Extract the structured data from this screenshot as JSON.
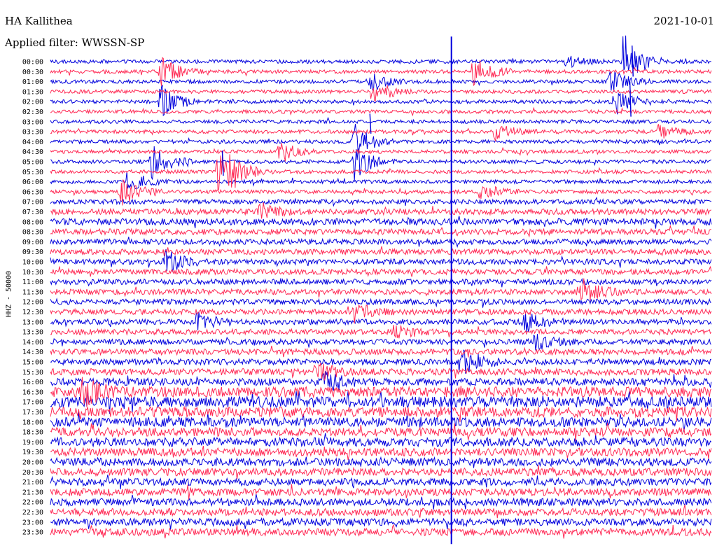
{
  "header": {
    "station": "HA Kallithea",
    "filter": "Applied filter: WWSSN-SP",
    "date": "2021-10-01"
  },
  "vertical_label": "HHZ - 50000",
  "colors": {
    "odd_trace": "#0000dd",
    "even_trace": "#ff2a55",
    "background": "#ffffff",
    "text": "#000000"
  },
  "chart_data": {
    "type": "line",
    "title": "HA Kallithea",
    "subtitle": "Applied filter: WWSSN-SP",
    "date": "2021-10-01",
    "ylabel": "HHZ - 50000",
    "grid": false,
    "row_labels": [
      "00:00",
      "00:30",
      "01:00",
      "01:30",
      "02:00",
      "02:30",
      "03:00",
      "03:30",
      "04:00",
      "04:30",
      "05:00",
      "05:30",
      "06:00",
      "06:30",
      "07:00",
      "07:30",
      "08:00",
      "08:30",
      "09:00",
      "09:30",
      "10:00",
      "10:30",
      "11:00",
      "11:30",
      "12:00",
      "12:30",
      "13:00",
      "13:30",
      "14:00",
      "14:30",
      "15:00",
      "15:30",
      "16:00",
      "16:30",
      "17:00",
      "17:30",
      "18:00",
      "18:30",
      "19:00",
      "19:30",
      "20:00",
      "20:30",
      "21:00",
      "21:30",
      "22:00",
      "22:30",
      "23:00",
      "23:30"
    ],
    "row_colors": [
      "blue",
      "red"
    ],
    "noise_level": [
      1,
      1,
      1,
      1,
      1,
      1,
      1,
      1,
      1,
      1,
      1,
      1,
      1,
      1,
      1.3,
      1.6,
      1.8,
      1.6,
      1.5,
      1.5,
      1.5,
      1.5,
      1.5,
      1.5,
      1.5,
      1.5,
      1.5,
      1.5,
      1.5,
      1.6,
      1.6,
      1.8,
      2,
      2.8,
      3,
      2.8,
      2.6,
      2.4,
      2.4,
      2.2,
      2.2,
      2.1,
      2,
      2,
      2,
      2,
      2,
      2
    ],
    "events": [
      {
        "row": 0,
        "minute": 23.3,
        "amplitude": 1.2
      },
      {
        "row": 0,
        "minute": 26.0,
        "amplitude": 5.0
      },
      {
        "row": 1,
        "minute": 5.0,
        "amplitude": 2.5
      },
      {
        "row": 1,
        "minute": 19.2,
        "amplitude": 2.8
      },
      {
        "row": 2,
        "minute": 14.5,
        "amplitude": 1.5
      },
      {
        "row": 2,
        "minute": 25.4,
        "amplitude": 2.0
      },
      {
        "row": 3,
        "minute": 14.6,
        "amplitude": 2.2
      },
      {
        "row": 4,
        "minute": 5.0,
        "amplitude": 3.0
      },
      {
        "row": 4,
        "minute": 25.6,
        "amplitude": 2.5
      },
      {
        "row": 7,
        "minute": 20.2,
        "amplitude": 1.5
      },
      {
        "row": 7,
        "minute": 27.6,
        "amplitude": 1.2
      },
      {
        "row": 8,
        "minute": 13.8,
        "amplitude": 3.0
      },
      {
        "row": 9,
        "minute": 10.4,
        "amplitude": 2.0
      },
      {
        "row": 10,
        "minute": 4.6,
        "amplitude": 3.0
      },
      {
        "row": 10,
        "minute": 13.8,
        "amplitude": 3.0
      },
      {
        "row": 11,
        "minute": 7.6,
        "amplitude": 4.0
      },
      {
        "row": 11,
        "minute": 8.2,
        "amplitude": 1.8
      },
      {
        "row": 12,
        "minute": 3.5,
        "amplitude": 2.0
      },
      {
        "row": 13,
        "minute": 3.2,
        "amplitude": 2.5
      },
      {
        "row": 13,
        "minute": 19.5,
        "amplitude": 1.5
      },
      {
        "row": 15,
        "minute": 9.5,
        "amplitude": 1.4
      },
      {
        "row": 20,
        "minute": 5.2,
        "amplitude": 2.0
      },
      {
        "row": 23,
        "minute": 24.0,
        "amplitude": 2.5
      },
      {
        "row": 25,
        "minute": 13.8,
        "amplitude": 1.6
      },
      {
        "row": 26,
        "minute": 6.6,
        "amplitude": 1.8
      },
      {
        "row": 26,
        "minute": 21.5,
        "amplitude": 1.6
      },
      {
        "row": 27,
        "minute": 15.6,
        "amplitude": 1.4
      },
      {
        "row": 28,
        "minute": 22.0,
        "amplitude": 1.8
      },
      {
        "row": 30,
        "minute": 18.6,
        "amplitude": 3.0
      },
      {
        "row": 31,
        "minute": 12.0,
        "amplitude": 1.6
      },
      {
        "row": 32,
        "minute": 12.4,
        "amplitude": 2.2
      },
      {
        "row": 33,
        "minute": 1.4,
        "amplitude": 2.5
      }
    ],
    "spikes": [
      {
        "row": 0,
        "minute": 26.4,
        "up_rows": 1.6,
        "down_rows": 1.5
      },
      {
        "row": 2,
        "minute": 26.3,
        "up_rows": 0,
        "down_rows": 3.5
      },
      {
        "row": 6,
        "minute": 14.5,
        "up_rows": 0.8,
        "down_rows": 1.2
      },
      {
        "row": 10,
        "minute": 7.8,
        "up_rows": 1.1,
        "down_rows": 1.4
      }
    ],
    "vertical_line": {
      "minute": 18.2,
      "row_start": -2.5,
      "row_end": 48.2
    }
  }
}
